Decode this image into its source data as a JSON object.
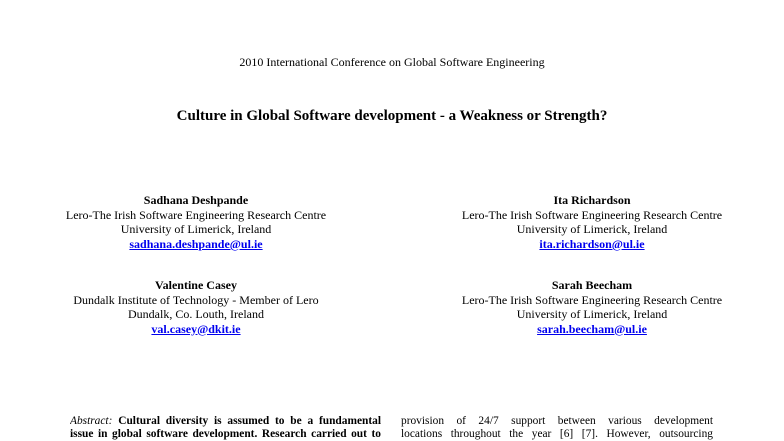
{
  "header": {
    "conference": "2010 International Conference on Global Software Engineering"
  },
  "paper": {
    "title": "Culture in Global Software development - a Weakness or Strength?"
  },
  "authors": [
    {
      "name": "Sadhana Deshpande",
      "affiliation": "Lero-The Irish Software Engineering Research Centre",
      "institution": "University of Limerick, Ireland",
      "email": "sadhana.deshpande@ul.ie"
    },
    {
      "name": "Ita Richardson",
      "affiliation": "Lero-The Irish Software Engineering Research Centre",
      "institution": "University of Limerick, Ireland",
      "email": "ita.richardson@ul.ie"
    },
    {
      "name": "Valentine Casey",
      "affiliation": "Dundalk Institute of Technology - Member of Lero",
      "institution": "Dundalk, Co. Louth, Ireland",
      "email": "val.casey@dkit.ie"
    },
    {
      "name": "Sarah Beecham",
      "affiliation": "Lero-The Irish Software Engineering Research Centre",
      "institution": "University of Limerick, Ireland",
      "email": "sarah.beecham@ul.ie"
    }
  ],
  "body": {
    "abstract_label": "Abstract:",
    "abstract_line1": "Cultural diversity is assumed to be a fundamental",
    "abstract_line2": "issue in global software development. Research carried out to",
    "right_line1": "provision of 24/7 support between various development",
    "right_line2": "locations throughout the year [6] [7]. However, outsourcing"
  }
}
